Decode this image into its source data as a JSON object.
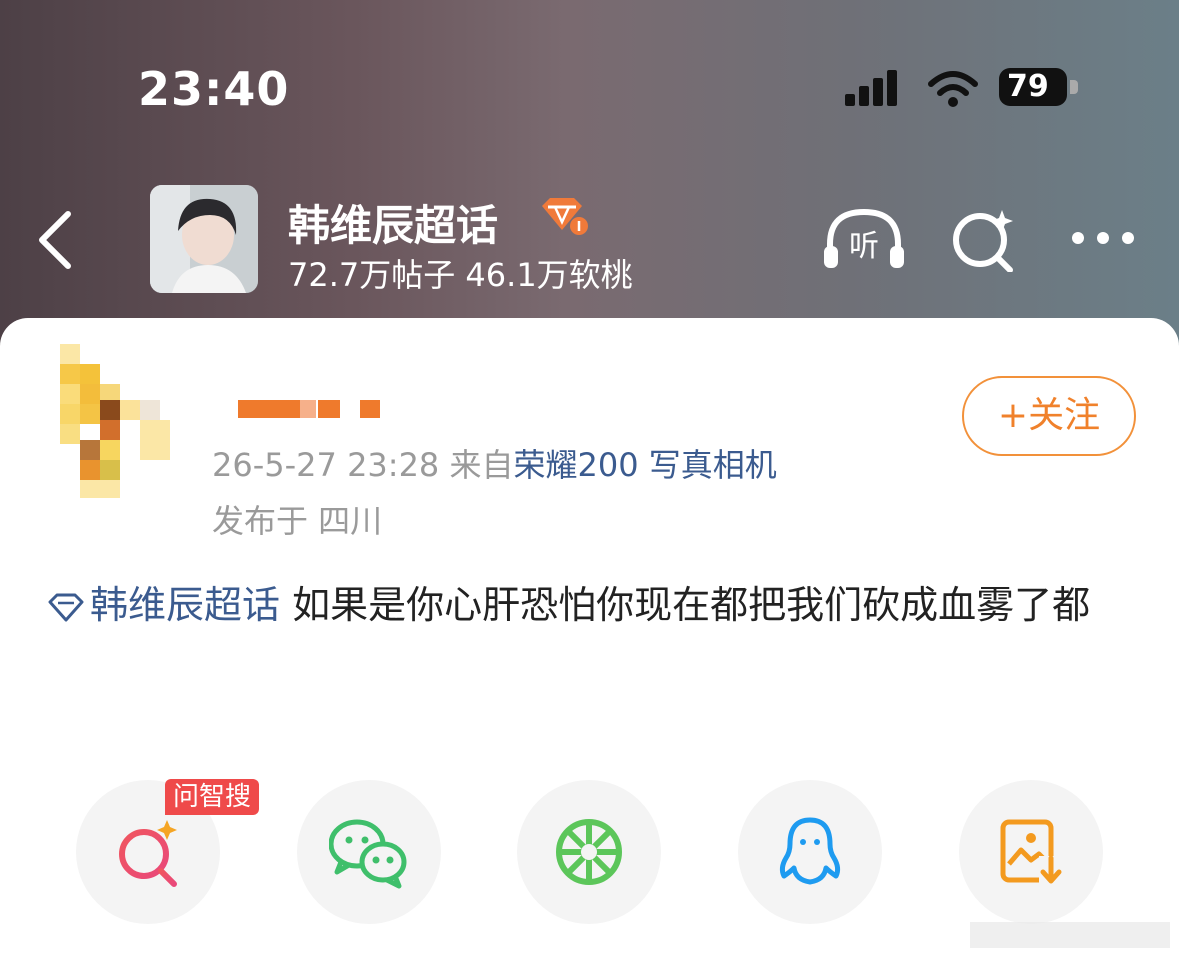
{
  "status_bar": {
    "time": "23:40",
    "battery": "79"
  },
  "header": {
    "title": "韩维辰超话",
    "stats": "72.7万帖子 46.1万软桃",
    "listen_label": "听"
  },
  "post": {
    "follow_label": "+关注",
    "meta_time": "26-5-27 23:28",
    "meta_from": "来自",
    "meta_device": "荣耀200 写真相机",
    "location": "发布于 四川",
    "tag": "韩维辰超话",
    "body": " 如果是你心肝恐怕你现在都把我们砍成血雾了都"
  },
  "share": {
    "wenzhi_badge": "问智搜",
    "icons": [
      "ai-search-icon",
      "wechat-icon",
      "moments-icon",
      "qq-icon",
      "save-image-icon"
    ]
  },
  "colors": {
    "follow": "#f0812b",
    "link": "#3b5b8f",
    "badge": "#ef4a4a"
  }
}
